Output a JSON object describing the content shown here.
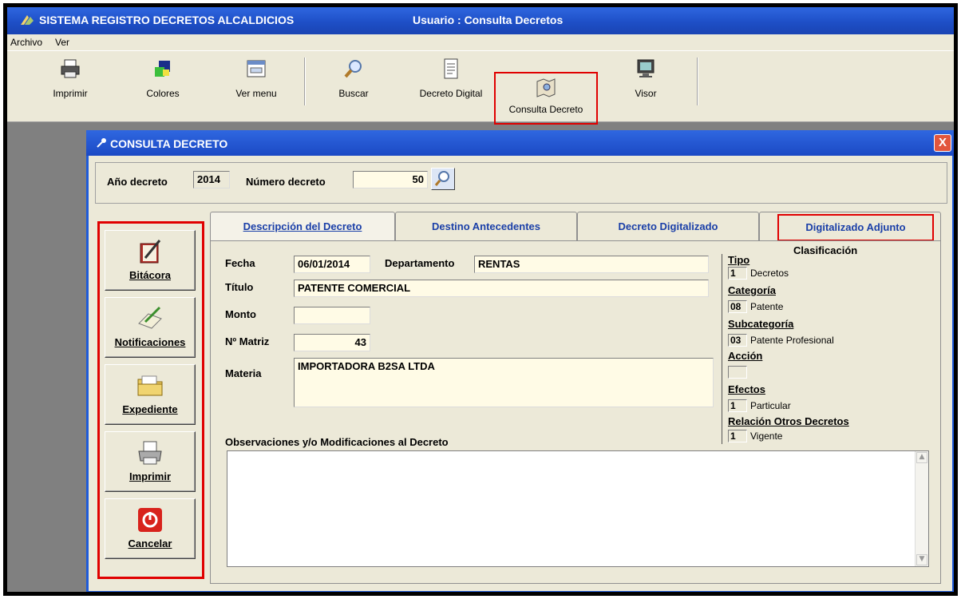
{
  "window": {
    "app_title": "SISTEMA REGISTRO DECRETOS ALCALDICIOS",
    "user_title": "Usuario : Consulta Decretos"
  },
  "menu": [
    "Archivo",
    "Ver"
  ],
  "toolbar": {
    "items": [
      {
        "label": "Imprimir",
        "icon": "printer-icon"
      },
      {
        "label": "Colores",
        "icon": "palette-icon"
      },
      {
        "label": "Ver menu",
        "icon": "window-icon"
      },
      {
        "label": "Buscar",
        "icon": "magnifier-icon"
      },
      {
        "label": "Decreto Digital",
        "icon": "document-icon"
      },
      {
        "label": "Consulta Decreto",
        "icon": "map-icon"
      },
      {
        "label": "Visor",
        "icon": "monitor-icon"
      }
    ]
  },
  "dialog": {
    "title": "CONSULTA DECRETO",
    "close_label": "X",
    "anio_label": "Año decreto",
    "anio_value": "2014",
    "numero_label": "Número decreto",
    "numero_value": "50"
  },
  "left_buttons": [
    {
      "label": "Bitácora",
      "icon": "book-pen-icon"
    },
    {
      "label": "Notificaciones",
      "icon": "pen-paper-icon"
    },
    {
      "label": "Expediente",
      "icon": "folder-icon"
    },
    {
      "label": "Imprimir",
      "icon": "printer-icon"
    },
    {
      "label": "Cancelar",
      "icon": "power-icon"
    }
  ],
  "tabs": [
    {
      "label": "Descripción del Decreto",
      "active": true
    },
    {
      "label": "Destino Antecedentes",
      "active": false
    },
    {
      "label": "Decreto Digitalizado",
      "active": false
    },
    {
      "label": "Digitalizado Adjunto",
      "active": false
    }
  ],
  "form": {
    "fecha_label": "Fecha",
    "fecha_value": "06/01/2014",
    "depto_label": "Departamento",
    "depto_value": "RENTAS",
    "titulo_label": "Título",
    "titulo_value": "PATENTE COMERCIAL",
    "monto_label": "Monto",
    "monto_value": "",
    "matriz_label": "Nº Matriz",
    "matriz_value": "43",
    "materia_label": "Materia",
    "materia_value": "IMPORTADORA B2SA LTDA",
    "obs_label": "Observaciones y/o Modificaciones al Decreto",
    "obs_value": ""
  },
  "clasificacion": {
    "title": "Clasificación",
    "tipo_label": "Tipo",
    "tipo_code": "1",
    "tipo_value": "Decretos",
    "categoria_label": "Categoría",
    "categoria_code": "08",
    "categoria_value": "Patente",
    "subcategoria_label": "Subcategoría",
    "subcategoria_code": "03",
    "subcategoria_value": "Patente Profesional",
    "accion_label": "Acción",
    "accion_code": "",
    "efectos_label": "Efectos",
    "efectos_code": "1",
    "efectos_value": "Particular",
    "relacion_label": "Relación Otros Decretos",
    "relacion_code": "1",
    "relacion_value": "Vigente"
  },
  "colors": {
    "title_blue": "#1e4fc7",
    "highlight_red": "#e00000",
    "field_bg": "#fffbe6"
  }
}
